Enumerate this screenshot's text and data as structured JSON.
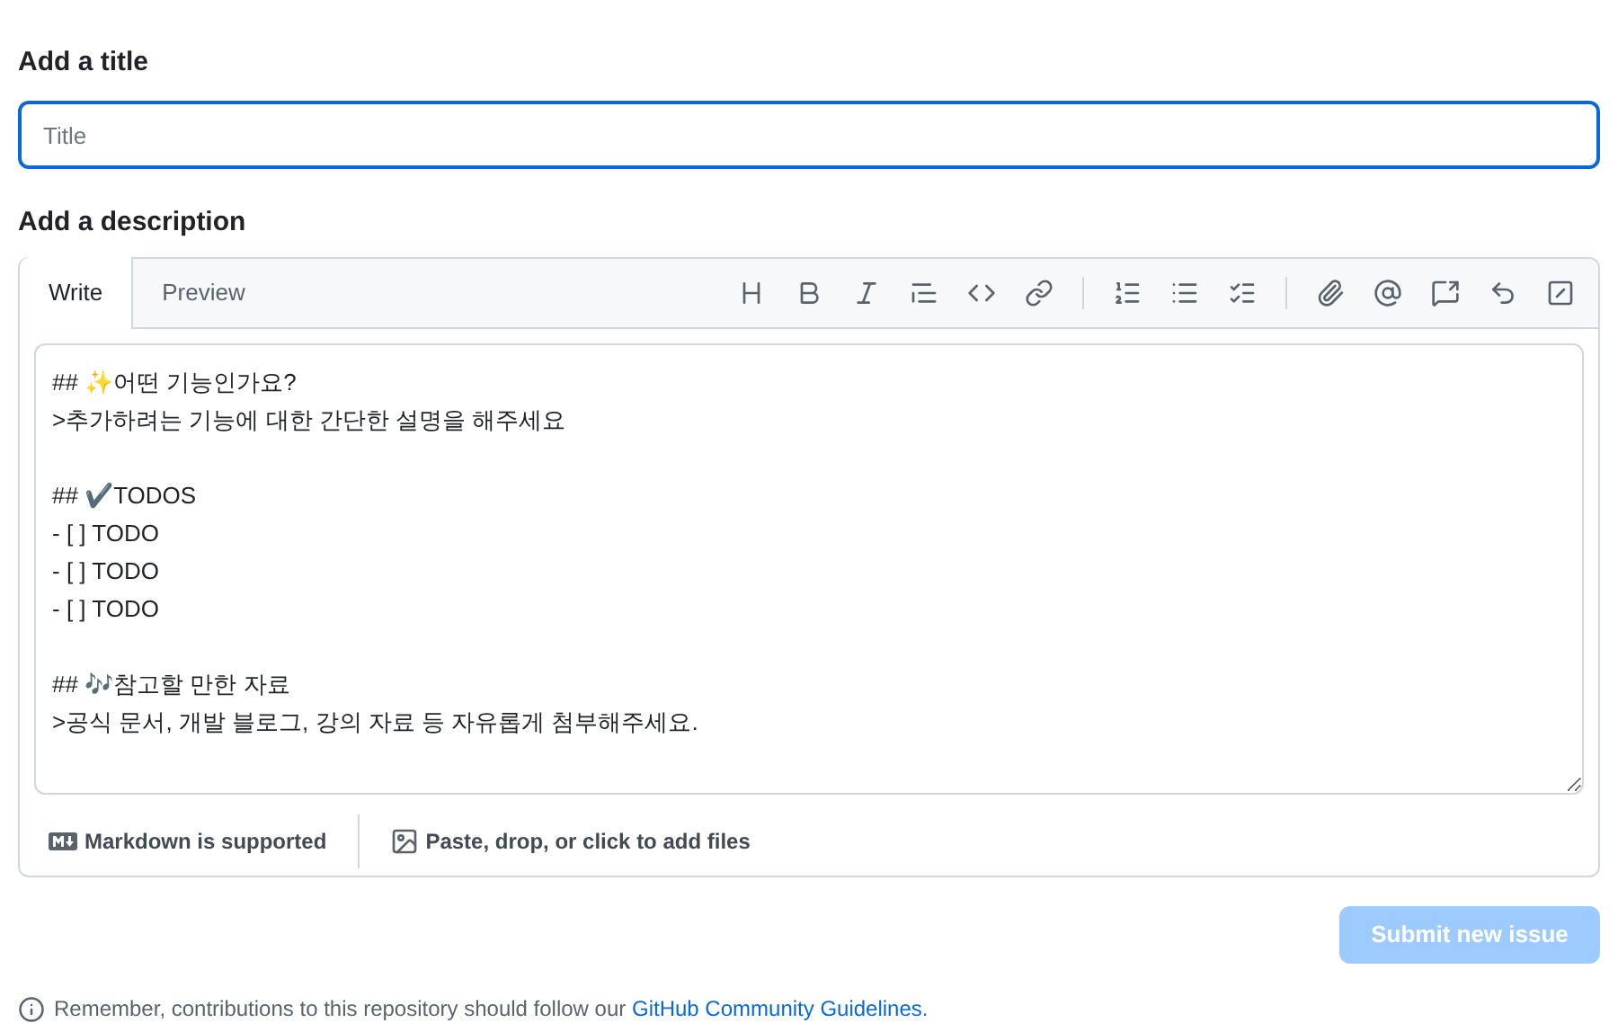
{
  "title_section": {
    "heading": "Add a title",
    "placeholder": "Title"
  },
  "description_section": {
    "heading": "Add a description",
    "tabs": [
      {
        "label": "Write",
        "selected": true
      },
      {
        "label": "Preview",
        "selected": false
      }
    ],
    "toolbar": [
      {
        "kind": "heading"
      },
      {
        "kind": "bold"
      },
      {
        "kind": "italic"
      },
      {
        "kind": "quote"
      },
      {
        "kind": "code"
      },
      {
        "kind": "link"
      },
      {
        "kind": "separator"
      },
      {
        "kind": "ordered"
      },
      {
        "kind": "unordered"
      },
      {
        "kind": "tasks"
      },
      {
        "kind": "separator"
      },
      {
        "kind": "attach"
      },
      {
        "kind": "mention"
      },
      {
        "kind": "reference"
      },
      {
        "kind": "reply"
      },
      {
        "kind": "slash"
      }
    ],
    "value": "## ✨어떤 기능인가요?\n>추가하려는 기능에 대한 간단한 설명을 해주세요\n\n## ✔️TODOS\n- [ ] TODO\n- [ ] TODO\n- [ ] TODO\n\n## 🎶참고할 만한 자료\n>공식 문서, 개발 블로그, 강의 자료 등 자유롭게 첨부해주세요.",
    "markdown_note": "Markdown is supported",
    "attach_note": "Paste, drop, or click to add files"
  },
  "submit_button": {
    "label": "Submit new issue",
    "disabled": true
  },
  "footer": {
    "text": "Remember, contributions to this repository should follow our ",
    "link": "GitHub Community Guidelines",
    "end": "."
  }
}
